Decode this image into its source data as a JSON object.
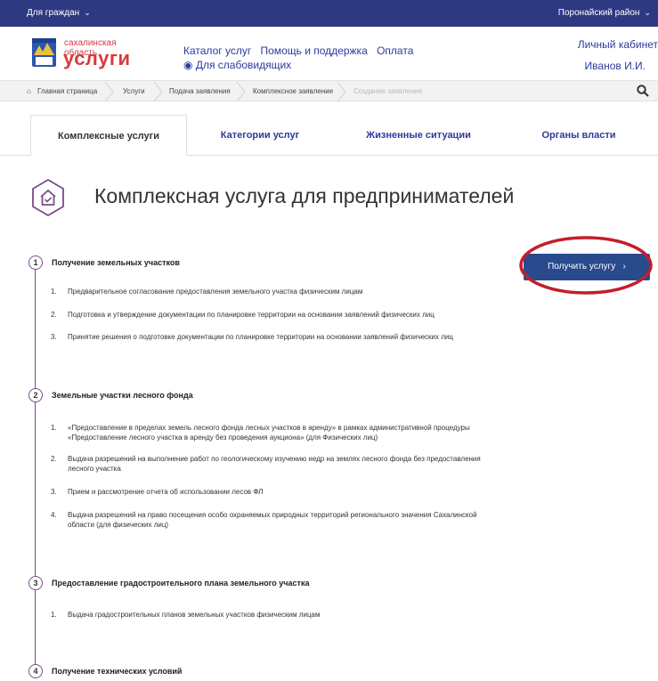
{
  "topbar": {
    "citizens_label": "Для граждан",
    "region_label": "Поронайский район"
  },
  "header": {
    "region_text": "сахалинская область",
    "brand_text": "услуги",
    "nav_links": [
      "Каталог услуг",
      "Помощь и поддержка",
      "Оплата"
    ],
    "accessibility_label": "Для слабовидящих",
    "cabinet_label": "Личный кабинет",
    "user_name": "Иванов И.И."
  },
  "breadcrumb": [
    "Главная страница",
    "Услуги",
    "Подача заявления",
    "Комплексное заявление",
    "Создание заявления"
  ],
  "tabs": [
    "Комплексные услуги",
    "Категории услуг",
    "Жизненные ситуации",
    "Органы власти"
  ],
  "page_title": "Комплексная услуга для предпринимателей",
  "get_service_button": "Получить услугу",
  "steps": [
    {
      "number": "1",
      "title": "Получение земельных участков",
      "items": [
        {
          "num": "1.",
          "text": "Предварительное согласование предоставления земельного участка физическим лицам"
        },
        {
          "num": "2.",
          "text": "Подготовка и утверждение документации по планировке территории на основании заявлений физических лиц"
        },
        {
          "num": "3.",
          "text": "Принятие решения о подготовке документации по планировке территории на основании заявлений физических лиц"
        }
      ]
    },
    {
      "number": "2",
      "title": "Земельные участки лесного фонда",
      "items": [
        {
          "num": "1.",
          "text": "«Предоставление в пределах земель лесного фонда лесных участков в аренду» в рамках административной процедуры «Предоставление лесного участка в аренду без проведения аукциона» (для Физических лиц)"
        },
        {
          "num": "2.",
          "text": "Выдача разрешений на выполнение работ по геологическому изучению недр на землях лесного фонда без предоставления лесного участка"
        },
        {
          "num": "3.",
          "text": "Прием и рассмотрение отчета об использовании лесов ФЛ"
        },
        {
          "num": "4.",
          "text": "Выдача разрешений на право посещения особо охраняемых природных территорий регионального значения Сахалинской области (для физических лиц)"
        }
      ]
    },
    {
      "number": "3",
      "title": "Предоставление градостроительного плана земельного участка",
      "items": [
        {
          "num": "1.",
          "text": "Выдача градостроительных планов земельных участков физическим лицам"
        }
      ]
    },
    {
      "number": "4",
      "title": "Получение технических условий",
      "items": []
    }
  ],
  "colors": {
    "topbar": "#2d3a82",
    "brand": "#d6393d",
    "link": "#2d3a9b",
    "accent": "#7a4b8a",
    "button": "#2a4a8e",
    "highlight": "#c41e2a"
  }
}
